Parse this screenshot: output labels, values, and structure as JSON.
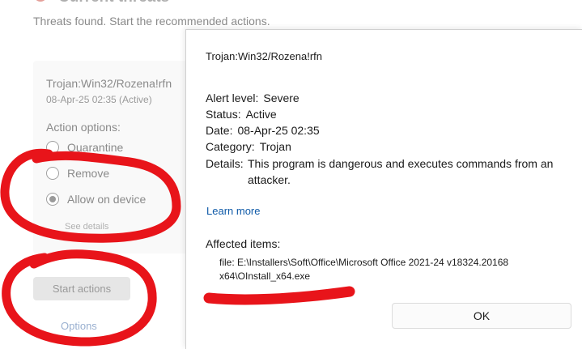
{
  "background": {
    "header_title": "Current threats",
    "subtitle": "Threats found. Start the recommended actions.",
    "threat_name": "Trojan:Win32/Rozena!rfn",
    "threat_date": "08-Apr-25 02:35 (Active)",
    "action_options_label": "Action options:",
    "options": [
      {
        "label": "Quarantine",
        "selected": false
      },
      {
        "label": "Remove",
        "selected": false
      },
      {
        "label": "Allow on device",
        "selected": true
      }
    ],
    "details_link": "See details",
    "start_actions": "Start actions",
    "options_link": "Options"
  },
  "dialog": {
    "threat_name": "Trojan:Win32/Rozena!rfn",
    "alert_level_key": "Alert level:",
    "alert_level_value": "Severe",
    "status_key": "Status:",
    "status_value": "Active",
    "date_key": "Date:",
    "date_value": "08-Apr-25 02:35",
    "category_key": "Category:",
    "category_value": "Trojan",
    "details_key": "Details:",
    "details_value": "This program is dangerous and executes commands from an attacker.",
    "learn_more": "Learn more",
    "affected_items_label": "Affected items:",
    "affected_file": "file: E:\\Installers\\Soft\\Office\\Microsoft Office 2021-24 v18324.20168 x64\\OInstall_x64.exe",
    "ok_label": "OK"
  },
  "colors": {
    "annotation_red": "#e8141a",
    "link_blue": "#0f5aa8",
    "severe_icon": "#c42b1c"
  }
}
